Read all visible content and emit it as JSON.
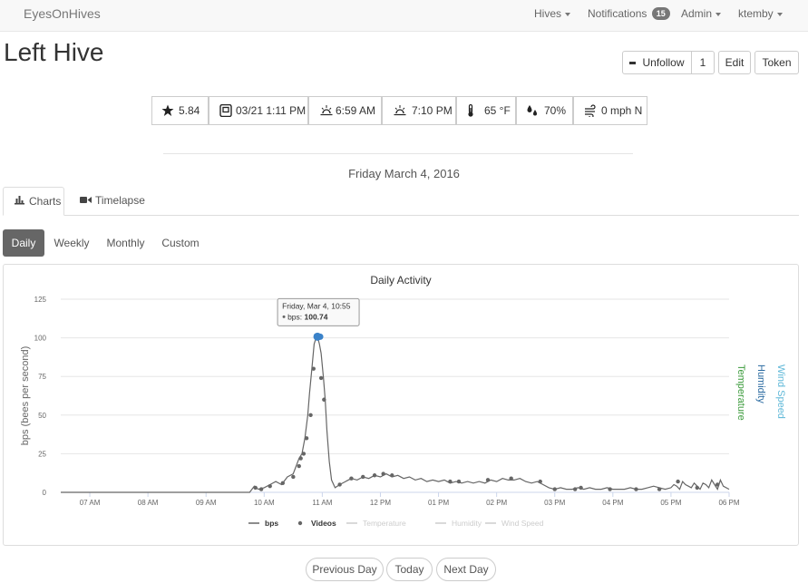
{
  "navbar": {
    "brand": "EyesOnHives",
    "hives_label": "Hives",
    "notifications_label": "Notifications",
    "notifications_count": "15",
    "admin_label": "Admin",
    "user_label": "ktemby"
  },
  "page": {
    "title": "Left Hive"
  },
  "actions": {
    "unfollow_label": "Unfollow",
    "follow_count": "1",
    "edit_label": "Edit",
    "token_label": "Token"
  },
  "stats": {
    "rating": "5.84",
    "last_seen": "03/21 1:11 PM",
    "sunrise": "6:59 AM",
    "sunset": "7:10 PM",
    "temperature": "65 °F",
    "humidity": "70%",
    "wind": "0 mph N"
  },
  "date_header": "Friday March 4, 2016",
  "tabs": {
    "charts": "Charts",
    "timelapse": "Timelapse"
  },
  "periods": {
    "daily": "Daily",
    "weekly": "Weekly",
    "monthly": "Monthly",
    "custom": "Custom"
  },
  "pager": {
    "previous": "Previous Day",
    "today": "Today",
    "next": "Next Day"
  },
  "colors": {
    "bps": "#666666",
    "temperature": "#3a9a3a",
    "humidity": "#2a6aa0",
    "wind": "#5fb8d8",
    "point_highlight": "#3a82c9"
  },
  "chart_data": {
    "type": "line",
    "title": "Daily Activity",
    "ylabel": "bps (bees per second)",
    "right_axis_labels": [
      "Temperature",
      "Humidity",
      "Wind Speed"
    ],
    "ylim": [
      0,
      125
    ],
    "yticks": [
      0,
      25,
      50,
      75,
      100,
      125
    ],
    "grid": true,
    "legend_placement": "bottom",
    "x_range_hours": [
      6.5,
      18.0
    ],
    "xticks": [
      {
        "h": 7,
        "label": "07 AM"
      },
      {
        "h": 8,
        "label": "08 AM"
      },
      {
        "h": 9,
        "label": "09 AM"
      },
      {
        "h": 10,
        "label": "10 AM"
      },
      {
        "h": 11,
        "label": "11 AM"
      },
      {
        "h": 12,
        "label": "12 PM"
      },
      {
        "h": 13,
        "label": "01 PM"
      },
      {
        "h": 14,
        "label": "02 PM"
      },
      {
        "h": 15,
        "label": "03 PM"
      },
      {
        "h": 16,
        "label": "04 PM"
      },
      {
        "h": 17,
        "label": "05 PM"
      },
      {
        "h": 18,
        "label": "06 PM"
      }
    ],
    "legend": [
      {
        "name": "bps",
        "active": true,
        "marker": "line"
      },
      {
        "name": "Videos",
        "active": true,
        "marker": "dot"
      },
      {
        "name": "Temperature",
        "active": false,
        "marker": "line"
      },
      {
        "name": "Humidity",
        "active": false,
        "marker": "line"
      },
      {
        "name": "Wind Speed",
        "active": false,
        "marker": "line"
      }
    ],
    "series": [
      {
        "name": "bps",
        "x": [
          6.5,
          9.75,
          9.83,
          9.9,
          10.0,
          10.1,
          10.2,
          10.3,
          10.4,
          10.5,
          10.55,
          10.6,
          10.65,
          10.7,
          10.75,
          10.78,
          10.82,
          10.86,
          10.9,
          10.917,
          10.95,
          10.98,
          11.02,
          11.05,
          11.08,
          11.12,
          11.16,
          11.22,
          11.3,
          11.4,
          11.5,
          11.6,
          11.7,
          11.8,
          11.9,
          12.0,
          12.1,
          12.2,
          12.3,
          12.4,
          12.5,
          12.6,
          12.7,
          12.8,
          12.9,
          13.0,
          13.1,
          13.2,
          13.3,
          13.4,
          13.5,
          13.6,
          13.7,
          13.8,
          13.9,
          14.0,
          14.1,
          14.2,
          14.3,
          14.4,
          14.5,
          14.6,
          14.7,
          14.8,
          14.9,
          15.0,
          15.1,
          15.2,
          15.3,
          15.4,
          15.5,
          15.6,
          15.7,
          15.8,
          15.9,
          16.0,
          16.1,
          16.2,
          16.3,
          16.4,
          16.5,
          16.6,
          16.7,
          16.8,
          16.9,
          17.0,
          17.05,
          17.1,
          17.15,
          17.2,
          17.25,
          17.3,
          17.35,
          17.4,
          17.45,
          17.5,
          17.55,
          17.6,
          17.65,
          17.7,
          17.75,
          17.8,
          17.85,
          17.9,
          18.0
        ],
        "values": [
          0,
          0,
          4,
          2,
          3,
          5,
          7,
          5,
          10,
          12,
          17,
          22,
          25,
          35,
          50,
          64,
          80,
          96,
          100.74,
          100.7,
          96,
          90,
          74,
          60,
          40,
          20,
          8,
          3,
          5,
          7,
          9,
          8,
          10,
          9,
          11,
          10,
          12,
          10,
          11,
          9,
          10,
          8,
          9,
          7,
          8,
          7,
          8,
          6,
          7,
          6,
          7,
          6,
          7,
          6,
          8,
          7,
          9,
          8,
          8,
          9,
          7,
          6,
          7,
          5,
          3,
          2,
          3,
          2,
          2,
          3,
          2,
          3,
          2,
          2,
          3,
          2,
          2,
          2,
          3,
          2,
          2,
          3,
          4,
          3,
          2,
          3,
          5,
          4,
          2,
          7,
          5,
          4,
          3,
          6,
          4,
          2,
          6,
          5,
          3,
          8,
          5,
          2,
          8,
          4,
          2
        ]
      }
    ],
    "video_points": [
      {
        "x": 9.85,
        "y": 3
      },
      {
        "x": 9.95,
        "y": 2
      },
      {
        "x": 10.1,
        "y": 4
      },
      {
        "x": 10.32,
        "y": 6
      },
      {
        "x": 10.5,
        "y": 10
      },
      {
        "x": 10.6,
        "y": 17
      },
      {
        "x": 10.63,
        "y": 22
      },
      {
        "x": 10.68,
        "y": 25
      },
      {
        "x": 10.73,
        "y": 35
      },
      {
        "x": 10.8,
        "y": 50
      },
      {
        "x": 10.85,
        "y": 80
      },
      {
        "x": 10.98,
        "y": 74
      },
      {
        "x": 11.03,
        "y": 60
      },
      {
        "x": 11.3,
        "y": 5
      },
      {
        "x": 11.5,
        "y": 9
      },
      {
        "x": 11.7,
        "y": 10
      },
      {
        "x": 11.9,
        "y": 11
      },
      {
        "x": 12.05,
        "y": 12
      },
      {
        "x": 12.2,
        "y": 11
      },
      {
        "x": 13.2,
        "y": 7
      },
      {
        "x": 13.35,
        "y": 7
      },
      {
        "x": 13.85,
        "y": 8
      },
      {
        "x": 14.25,
        "y": 9
      },
      {
        "x": 14.75,
        "y": 7
      },
      {
        "x": 15.0,
        "y": 2
      },
      {
        "x": 15.35,
        "y": 2
      },
      {
        "x": 15.45,
        "y": 3
      },
      {
        "x": 15.95,
        "y": 2
      },
      {
        "x": 16.4,
        "y": 2
      },
      {
        "x": 16.8,
        "y": 2
      },
      {
        "x": 17.12,
        "y": 7
      },
      {
        "x": 17.45,
        "y": 3
      },
      {
        "x": 17.8,
        "y": 5
      }
    ],
    "highlight_point": {
      "x": 10.917,
      "y": 100.74
    },
    "tooltip": {
      "title": "Friday, Mar 4, 10:55",
      "series": "bps",
      "value": "100.74"
    }
  }
}
